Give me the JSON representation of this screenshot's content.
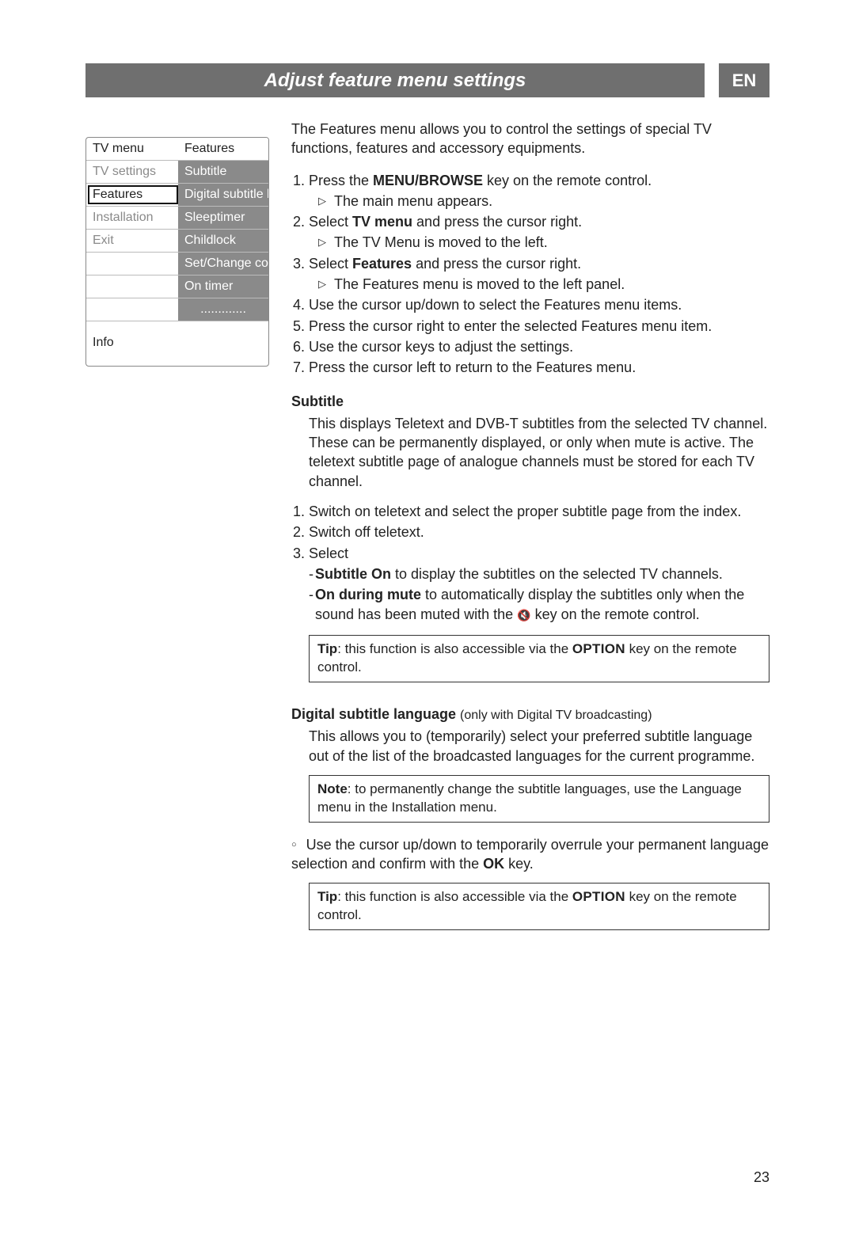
{
  "title": "Adjust feature menu settings",
  "langTab": "EN",
  "pageNumber": "23",
  "menu": {
    "leftHeader": "TV menu",
    "rightHeader": "Features",
    "rows": [
      {
        "left": "TV settings",
        "right": "Subtitle",
        "selected": false
      },
      {
        "left": "Features",
        "right": "Digital subtitle lan..",
        "selected": true
      },
      {
        "left": "Installation",
        "right": "Sleeptimer",
        "selected": false
      },
      {
        "left": "Exit",
        "right": "Childlock",
        "selected": false
      },
      {
        "left": "",
        "right": "Set/Change code",
        "selected": false
      },
      {
        "left": "",
        "right": "On timer",
        "selected": false
      },
      {
        "left": "",
        "right": ".............",
        "selected": false,
        "dots": true
      }
    ],
    "info": "Info"
  },
  "intro": "The Features menu allows you to control the settings of special TV functions, features and accessory equipments.",
  "steps": [
    {
      "text_a": "Press the ",
      "bold_a": "MENU/BROWSE",
      "text_b": " key on the remote control.",
      "sub": "The main menu appears."
    },
    {
      "text_a": "Select ",
      "bold_a": "TV menu",
      "text_b": " and press the cursor right.",
      "sub": "The TV Menu is moved to the left."
    },
    {
      "text_a": "Select ",
      "bold_a": "Features",
      "text_b": " and press the cursor right.",
      "sub": "The Features menu is moved to the left panel."
    },
    {
      "text_a": "Use the cursor up/down to select the Features menu items.",
      "bold_a": "",
      "text_b": "",
      "sub": ""
    },
    {
      "text_a": "Press the cursor right to enter the selected Features menu item.",
      "bold_a": "",
      "text_b": "",
      "sub": ""
    },
    {
      "text_a": "Use the cursor keys to adjust the settings.",
      "bold_a": "",
      "text_b": "",
      "sub": ""
    },
    {
      "text_a": "Press the cursor left to return to the Features menu.",
      "bold_a": "",
      "text_b": "",
      "sub": ""
    }
  ],
  "subtitleSection": {
    "heading": "Subtitle",
    "body": "This displays Teletext and DVB-T subtitles from the selected TV channel. These can be permanently displayed, or only when mute is active. The teletext subtitle page of analogue channels must be stored for each TV channel.",
    "steps": {
      "s1": "Switch on teletext and select the proper subtitle page from the index.",
      "s2": "Switch off teletext.",
      "s3": "Select",
      "opt1_bold": "Subtitle On",
      "opt1_rest": " to display the subtitles on the selected TV channels.",
      "opt2_bold": "On during mute",
      "opt2_rest_a": " to automatically display the subtitles only when the sound has been muted with the ",
      "opt2_rest_b": " key on the remote control."
    },
    "tip_a": "Tip",
    "tip_b": ": this function is also accessible via the ",
    "tip_key": "OPTION",
    "tip_c": " key on the remote control."
  },
  "dslSection": {
    "heading": "Digital subtitle language",
    "note": " (only with Digital TV broadcasting)",
    "body": "This allows you to (temporarily) select your preferred subtitle language out of the list of the broadcasted languages for the current programme.",
    "noteBox_a": "Note",
    "noteBox_b": ": to permanently change the subtitle languages, use the Language menu in the Installation menu.",
    "bullet_a": "Use the cursor up/down to temporarily overrule your permanent language selection and confirm with the ",
    "bullet_key": "OK",
    "bullet_b": " key.",
    "tip_a": "Tip",
    "tip_b": ": this function is also accessible via the ",
    "tip_key": "OPTION",
    "tip_c": " key on the remote control."
  }
}
